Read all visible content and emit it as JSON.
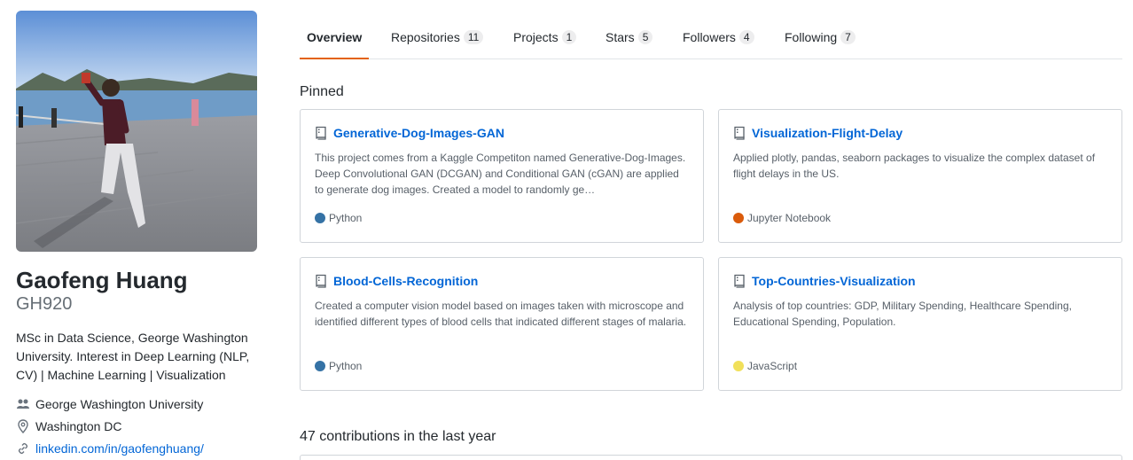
{
  "profile": {
    "full_name": "Gaofeng Huang",
    "username": "GH920",
    "bio": "MSc in Data Science, George Washington University. Interest in Deep Learning (NLP, CV) | Machine Learning | Visualization",
    "organization": "George Washington University",
    "location": "Washington DC",
    "website": "linkedin.com/in/gaofenghuang/",
    "icons": {
      "organization": "people-icon",
      "location": "location-pin-icon",
      "website": "link-icon"
    }
  },
  "tabs": [
    {
      "label": "Overview",
      "count": null,
      "selected": true
    },
    {
      "label": "Repositories",
      "count": "11",
      "selected": false
    },
    {
      "label": "Projects",
      "count": "1",
      "selected": false
    },
    {
      "label": "Stars",
      "count": "5",
      "selected": false
    },
    {
      "label": "Followers",
      "count": "4",
      "selected": false
    },
    {
      "label": "Following",
      "count": "7",
      "selected": false
    }
  ],
  "pinned": {
    "title": "Pinned",
    "repos": [
      {
        "name": "Generative-Dog-Images-GAN",
        "description": "This project comes from a Kaggle Competiton named Generative-Dog-Images. Deep Convolutional GAN (DCGAN) and Conditional GAN (cGAN) are applied to generate dog images. Created a model to randomly ge…",
        "language": "Python",
        "language_color": "#3572A5"
      },
      {
        "name": "Visualization-Flight-Delay",
        "description": "Applied plotly, pandas, seaborn packages to visualize the complex dataset of flight delays in the US.",
        "language": "Jupyter Notebook",
        "language_color": "#DA5B0B"
      },
      {
        "name": "Blood-Cells-Recognition",
        "description": "Created a computer vision model based on images taken with microscope and identified different types of blood cells that indicated different stages of malaria.",
        "language": "Python",
        "language_color": "#3572A5"
      },
      {
        "name": "Top-Countries-Visualization",
        "description": "Analysis of top countries: GDP, Military Spending, Healthcare Spending, Educational Spending, Population.",
        "language": "JavaScript",
        "language_color": "#F1E05A"
      }
    ]
  },
  "contributions": {
    "summary": "47 contributions in the last year"
  },
  "colors": {
    "accent_tab": "#e36209",
    "link": "#0366d6"
  }
}
